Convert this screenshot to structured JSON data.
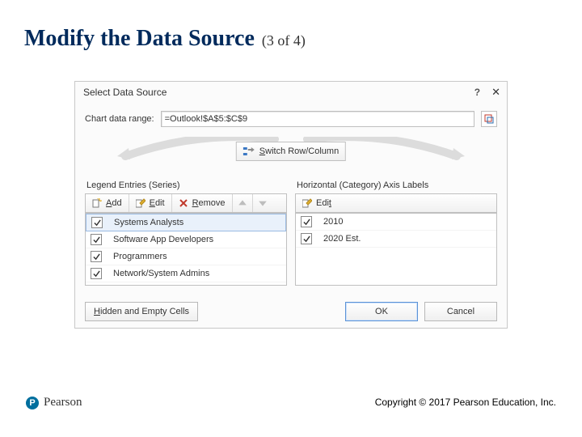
{
  "slide": {
    "title": "Modify the Data Source",
    "counter": "(3 of 4)"
  },
  "dialog": {
    "title": "Select Data Source",
    "chart_range_label": "Chart data range:",
    "chart_range_value": "=Outlook!$A$5:$C$9",
    "switch_label": "Switch Row/Column",
    "series_panel_title": "Legend Entries (Series)",
    "axis_panel_title": "Horizontal (Category) Axis Labels",
    "buttons": {
      "add": "Add",
      "edit": "Edit",
      "remove": "Remove",
      "hidden": "Hidden and Empty Cells",
      "ok": "OK",
      "cancel": "Cancel"
    },
    "series": [
      {
        "label": "Systems Analysts",
        "checked": true,
        "selected": true
      },
      {
        "label": "Software App Developers",
        "checked": true,
        "selected": false
      },
      {
        "label": "Programmers",
        "checked": true,
        "selected": false
      },
      {
        "label": "Network/System Admins",
        "checked": true,
        "selected": false
      }
    ],
    "categories": [
      {
        "label": "2010",
        "checked": true
      },
      {
        "label": "2020 Est.",
        "checked": true
      }
    ]
  },
  "brand": {
    "name": "Pearson",
    "badge": "P"
  },
  "copyright": "Copyright © 2017 Pearson Education, Inc."
}
